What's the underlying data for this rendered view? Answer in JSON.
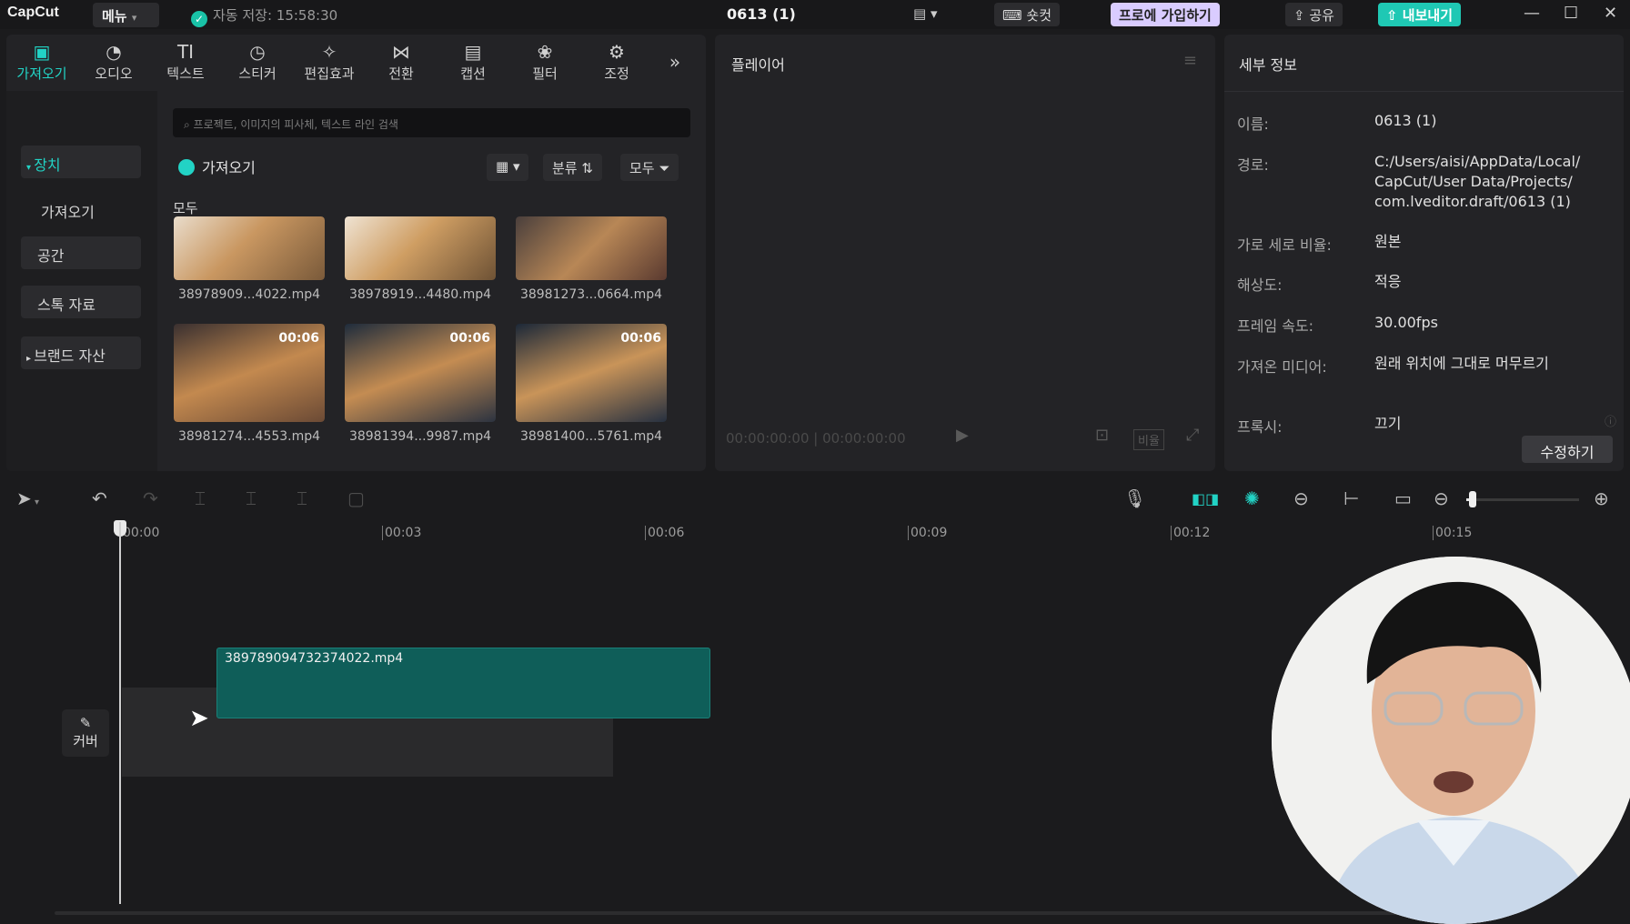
{
  "app": {
    "logo": "CapCut",
    "menu_label": "메뉴",
    "autosave": "자동 저장: 15:58:30",
    "project_title": "0613 (1)"
  },
  "titlebar": {
    "shortcut_label": "숏컷",
    "pro_label": "프로에 가입하기",
    "share_label": "공유",
    "export_label": "내보내기"
  },
  "toolbar": {
    "tools": [
      {
        "label": "가져오기",
        "icon": "import-icon"
      },
      {
        "label": "오디오",
        "icon": "audio-icon"
      },
      {
        "label": "텍스트",
        "icon": "text-icon"
      },
      {
        "label": "스티커",
        "icon": "sticker-icon"
      },
      {
        "label": "편집효과",
        "icon": "effects-icon"
      },
      {
        "label": "전환",
        "icon": "transition-icon"
      },
      {
        "label": "캡션",
        "icon": "caption-icon"
      },
      {
        "label": "필터",
        "icon": "filter-icon"
      },
      {
        "label": "조정",
        "icon": "adjust-icon"
      }
    ]
  },
  "sidebar": {
    "items": [
      {
        "label": "장치"
      },
      {
        "label": "가져오기"
      },
      {
        "label": "공간"
      },
      {
        "label": "스톡 자료"
      },
      {
        "label": "브랜드 자산"
      }
    ]
  },
  "media": {
    "search_placeholder": "프로젝트, 이미지의 피사체, 텍스트 라인 검색",
    "import_label": "가져오기",
    "sort_label": "분류",
    "filter_label": "모두",
    "section_label": "모두",
    "items": [
      {
        "name": "38978909...4022.mp4",
        "duration": ""
      },
      {
        "name": "38978919...4480.mp4",
        "duration": ""
      },
      {
        "name": "38981273...0664.mp4",
        "duration": ""
      },
      {
        "name": "38981274...4553.mp4",
        "duration": "00:06"
      },
      {
        "name": "38981394...9987.mp4",
        "duration": "00:06"
      },
      {
        "name": "38981400...5761.mp4",
        "duration": "00:06"
      }
    ]
  },
  "player": {
    "title": "플레이어",
    "timecode": "00:00:00:00 | 00:00:00:00",
    "ratio_label": "비율"
  },
  "details": {
    "title": "세부 정보",
    "rows": [
      {
        "key": "이름:",
        "value": "0613 (1)"
      },
      {
        "key": "경로:",
        "value": "C:/Users/aisi/AppData/Local/ CapCut/User Data/Projects/ com.lveditor.draft/0613 (1)"
      },
      {
        "key": "가로 세로 비율:",
        "value": "원본"
      },
      {
        "key": "해상도:",
        "value": "적응"
      },
      {
        "key": "프레임 속도:",
        "value": "30.00fps"
      },
      {
        "key": "가져온 미디어:",
        "value": "원래 위치에 그대로 머무르기"
      },
      {
        "key": "프록시:",
        "value": "끄기"
      }
    ],
    "edit_label": "수정하기"
  },
  "timeline": {
    "ruler": [
      "00:00",
      "00:03",
      "00:06",
      "00:09",
      "00:12",
      "00:15"
    ],
    "clip_name": "389789094732374022.mp4",
    "cover_label": "커버",
    "zoom_level": 0.06
  },
  "colors": {
    "accent": "#22d3c5",
    "clip": "#0f5e59",
    "pro": "#d9ccff",
    "export": "#1fc8b4"
  }
}
